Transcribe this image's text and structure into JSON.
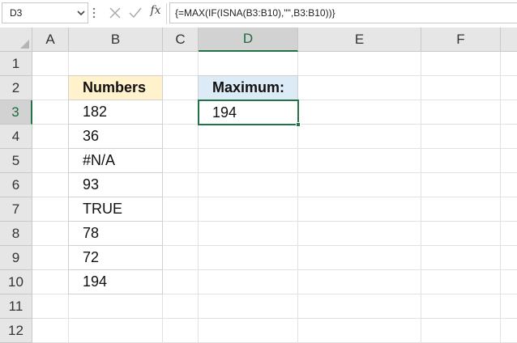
{
  "formula_bar": {
    "name_box": "D3",
    "formula": "{=MAX(IF(ISNA(B3:B10),\"\",B3:B10))}",
    "fx_label": "fx",
    "icons": {
      "dropdown": "chevron-down-icon",
      "cancel": "close-icon",
      "enter": "check-icon"
    }
  },
  "columns": [
    "A",
    "B",
    "C",
    "D",
    "E",
    "F"
  ],
  "rows": [
    "1",
    "2",
    "3",
    "4",
    "5",
    "6",
    "7",
    "8",
    "9",
    "10",
    "11",
    "12"
  ],
  "active_cell": {
    "column": "D",
    "row": "3"
  },
  "cells": {
    "B2": "Numbers",
    "B3": "182",
    "B4": "36",
    "B5": "#N/A",
    "B6": "93",
    "B7": "TRUE",
    "B8": "78",
    "B9": "72",
    "B10": "194",
    "D2": "Maximum:",
    "D3": "194"
  },
  "colors": {
    "accent": "#217346",
    "numbers_header_fill": "#fff2cc",
    "maximum_header_fill": "#ddebf7"
  }
}
